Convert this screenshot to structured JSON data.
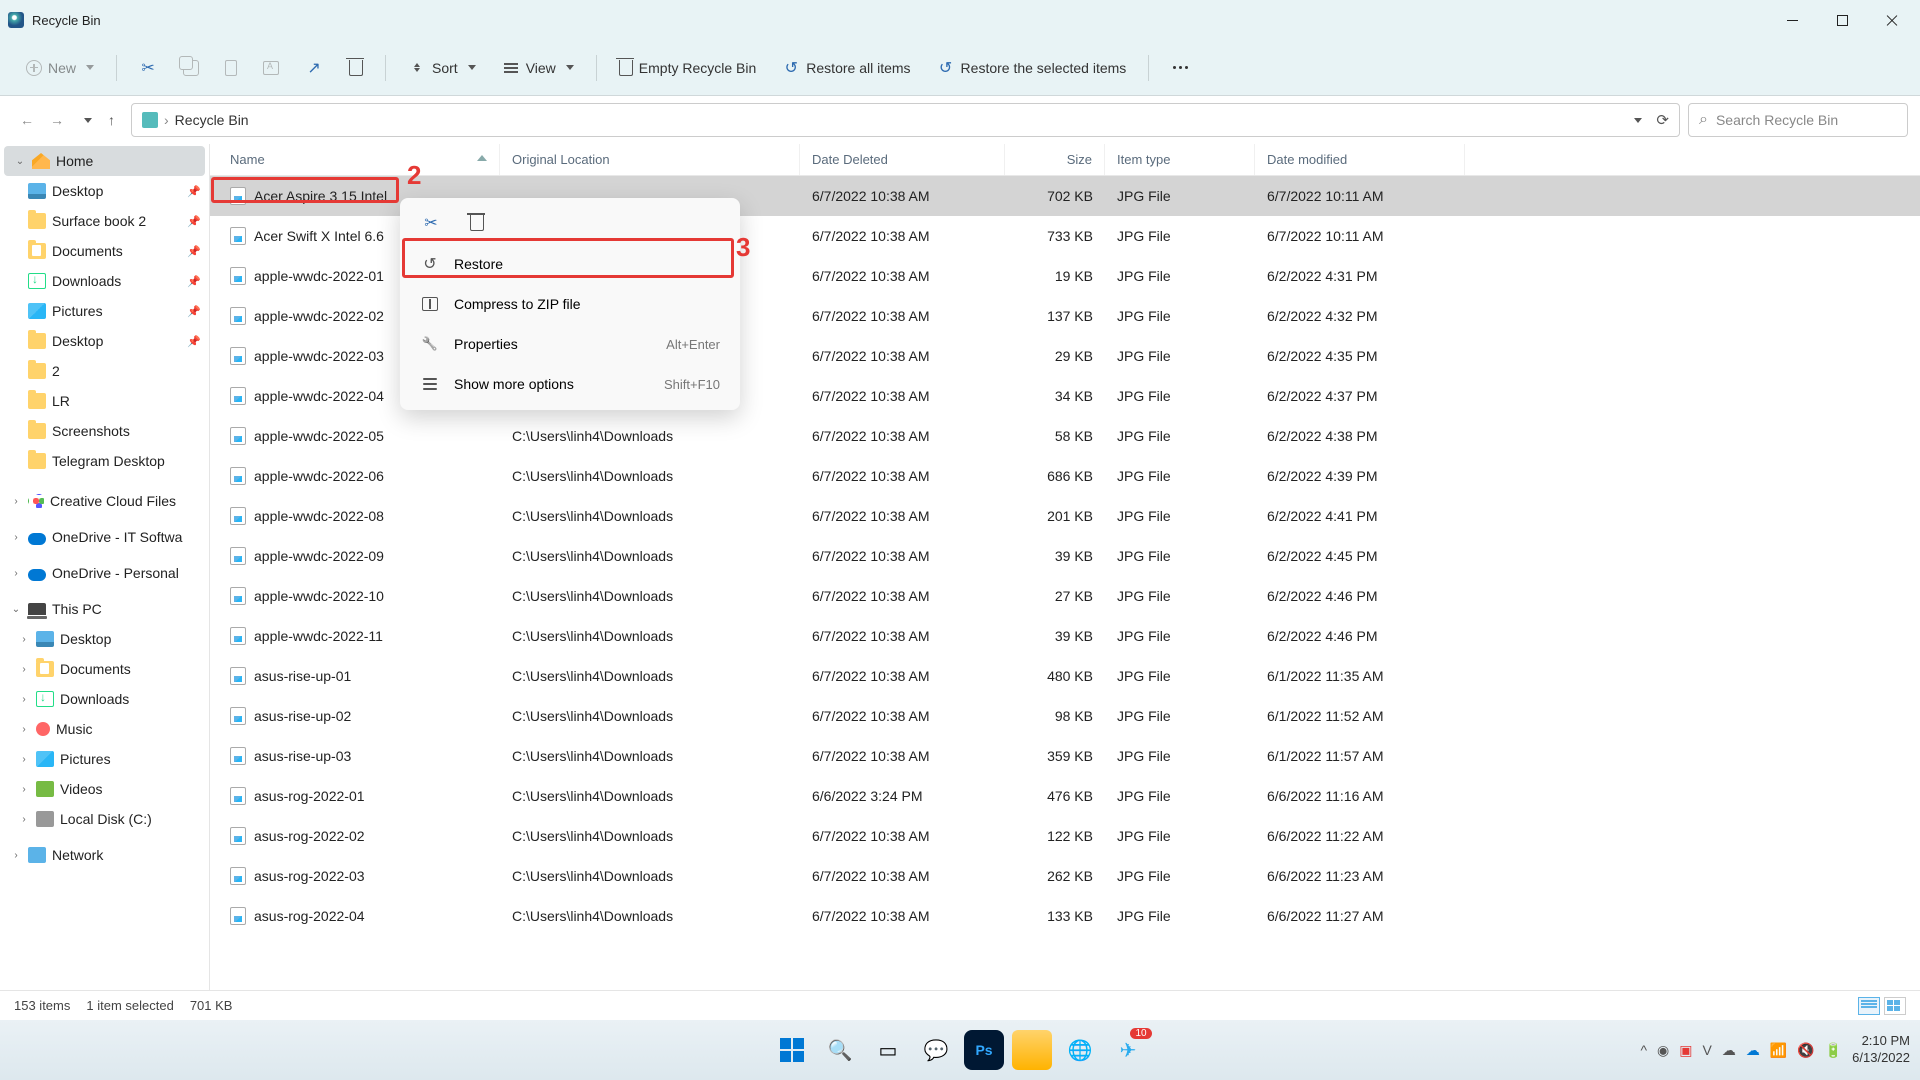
{
  "window": {
    "title": "Recycle Bin"
  },
  "toolbar": {
    "new_label": "New",
    "sort_label": "Sort",
    "view_label": "View",
    "empty_label": "Empty Recycle Bin",
    "restore_all_label": "Restore all items",
    "restore_selected_label": "Restore the selected items"
  },
  "breadcrumb": {
    "path": "Recycle Bin"
  },
  "search": {
    "placeholder": "Search Recycle Bin"
  },
  "columns": {
    "name": "Name",
    "location": "Original Location",
    "deleted": "Date Deleted",
    "size": "Size",
    "type": "Item type",
    "modified": "Date modified"
  },
  "sidebar": {
    "home": "Home",
    "quick": [
      {
        "label": "Desktop",
        "icon": "desktop",
        "pinned": true
      },
      {
        "label": "Surface book 2",
        "icon": "folder",
        "pinned": true
      },
      {
        "label": "Documents",
        "icon": "folder-docs",
        "pinned": true
      },
      {
        "label": "Downloads",
        "icon": "dl",
        "pinned": true
      },
      {
        "label": "Pictures",
        "icon": "pic",
        "pinned": true
      },
      {
        "label": "Desktop",
        "icon": "folder",
        "pinned": true
      },
      {
        "label": "2",
        "icon": "folder",
        "pinned": false
      },
      {
        "label": "LR",
        "icon": "folder",
        "pinned": false
      },
      {
        "label": "Screenshots",
        "icon": "folder",
        "pinned": false
      },
      {
        "label": "Telegram Desktop",
        "icon": "folder",
        "pinned": false
      }
    ],
    "creative_cloud": "Creative Cloud Files",
    "onedrive_it": "OneDrive - IT Softwa",
    "onedrive_personal": "OneDrive - Personal",
    "this_pc": "This PC",
    "pc_items": [
      {
        "label": "Desktop",
        "icon": "desktop"
      },
      {
        "label": "Documents",
        "icon": "folder-docs"
      },
      {
        "label": "Downloads",
        "icon": "dl"
      },
      {
        "label": "Music",
        "icon": "music"
      },
      {
        "label": "Pictures",
        "icon": "pic"
      },
      {
        "label": "Videos",
        "icon": "video"
      },
      {
        "label": "Local Disk (C:)",
        "icon": "disk"
      }
    ],
    "network": "Network"
  },
  "context_menu": {
    "restore": "Restore",
    "compress": "Compress to ZIP file",
    "properties": "Properties",
    "properties_shortcut": "Alt+Enter",
    "show_more": "Show more options",
    "show_more_shortcut": "Shift+F10"
  },
  "files": [
    {
      "name": "Acer Aspire 3 15 Intel",
      "loc": "",
      "deleted": "6/7/2022 10:38 AM",
      "size": "702 KB",
      "type": "JPG File",
      "modified": "6/7/2022 10:11 AM",
      "selected": true
    },
    {
      "name": "Acer Swift X Intel 6.6",
      "loc": "",
      "deleted": "6/7/2022 10:38 AM",
      "size": "733 KB",
      "type": "JPG File",
      "modified": "6/7/2022 10:11 AM"
    },
    {
      "name": "apple-wwdc-2022-01",
      "loc": "",
      "deleted": "6/7/2022 10:38 AM",
      "size": "19 KB",
      "type": "JPG File",
      "modified": "6/2/2022 4:31 PM"
    },
    {
      "name": "apple-wwdc-2022-02",
      "loc": "",
      "deleted": "6/7/2022 10:38 AM",
      "size": "137 KB",
      "type": "JPG File",
      "modified": "6/2/2022 4:32 PM"
    },
    {
      "name": "apple-wwdc-2022-03",
      "loc": "",
      "deleted": "6/7/2022 10:38 AM",
      "size": "29 KB",
      "type": "JPG File",
      "modified": "6/2/2022 4:35 PM"
    },
    {
      "name": "apple-wwdc-2022-04",
      "loc": "",
      "deleted": "6/7/2022 10:38 AM",
      "size": "34 KB",
      "type": "JPG File",
      "modified": "6/2/2022 4:37 PM"
    },
    {
      "name": "apple-wwdc-2022-05",
      "loc": "C:\\Users\\linh4\\Downloads",
      "deleted": "6/7/2022 10:38 AM",
      "size": "58 KB",
      "type": "JPG File",
      "modified": "6/2/2022 4:38 PM"
    },
    {
      "name": "apple-wwdc-2022-06",
      "loc": "C:\\Users\\linh4\\Downloads",
      "deleted": "6/7/2022 10:38 AM",
      "size": "686 KB",
      "type": "JPG File",
      "modified": "6/2/2022 4:39 PM"
    },
    {
      "name": "apple-wwdc-2022-08",
      "loc": "C:\\Users\\linh4\\Downloads",
      "deleted": "6/7/2022 10:38 AM",
      "size": "201 KB",
      "type": "JPG File",
      "modified": "6/2/2022 4:41 PM"
    },
    {
      "name": "apple-wwdc-2022-09",
      "loc": "C:\\Users\\linh4\\Downloads",
      "deleted": "6/7/2022 10:38 AM",
      "size": "39 KB",
      "type": "JPG File",
      "modified": "6/2/2022 4:45 PM"
    },
    {
      "name": "apple-wwdc-2022-10",
      "loc": "C:\\Users\\linh4\\Downloads",
      "deleted": "6/7/2022 10:38 AM",
      "size": "27 KB",
      "type": "JPG File",
      "modified": "6/2/2022 4:46 PM"
    },
    {
      "name": "apple-wwdc-2022-11",
      "loc": "C:\\Users\\linh4\\Downloads",
      "deleted": "6/7/2022 10:38 AM",
      "size": "39 KB",
      "type": "JPG File",
      "modified": "6/2/2022 4:46 PM"
    },
    {
      "name": "asus-rise-up-01",
      "loc": "C:\\Users\\linh4\\Downloads",
      "deleted": "6/7/2022 10:38 AM",
      "size": "480 KB",
      "type": "JPG File",
      "modified": "6/1/2022 11:35 AM"
    },
    {
      "name": "asus-rise-up-02",
      "loc": "C:\\Users\\linh4\\Downloads",
      "deleted": "6/7/2022 10:38 AM",
      "size": "98 KB",
      "type": "JPG File",
      "modified": "6/1/2022 11:52 AM"
    },
    {
      "name": "asus-rise-up-03",
      "loc": "C:\\Users\\linh4\\Downloads",
      "deleted": "6/7/2022 10:38 AM",
      "size": "359 KB",
      "type": "JPG File",
      "modified": "6/1/2022 11:57 AM"
    },
    {
      "name": "asus-rog-2022-01",
      "loc": "C:\\Users\\linh4\\Downloads",
      "deleted": "6/6/2022 3:24 PM",
      "size": "476 KB",
      "type": "JPG File",
      "modified": "6/6/2022 11:16 AM"
    },
    {
      "name": "asus-rog-2022-02",
      "loc": "C:\\Users\\linh4\\Downloads",
      "deleted": "6/7/2022 10:38 AM",
      "size": "122 KB",
      "type": "JPG File",
      "modified": "6/6/2022 11:22 AM"
    },
    {
      "name": "asus-rog-2022-03",
      "loc": "C:\\Users\\linh4\\Downloads",
      "deleted": "6/7/2022 10:38 AM",
      "size": "262 KB",
      "type": "JPG File",
      "modified": "6/6/2022 11:23 AM"
    },
    {
      "name": "asus-rog-2022-04",
      "loc": "C:\\Users\\linh4\\Downloads",
      "deleted": "6/7/2022 10:38 AM",
      "size": "133 KB",
      "type": "JPG File",
      "modified": "6/6/2022 11:27 AM"
    }
  ],
  "status": {
    "items": "153 items",
    "selected": "1 item selected",
    "size": "701 KB"
  },
  "annotations": {
    "two": "2",
    "three": "3"
  },
  "clock": {
    "time": "2:10 PM",
    "date": "6/13/2022"
  },
  "telegram_badge": "10"
}
